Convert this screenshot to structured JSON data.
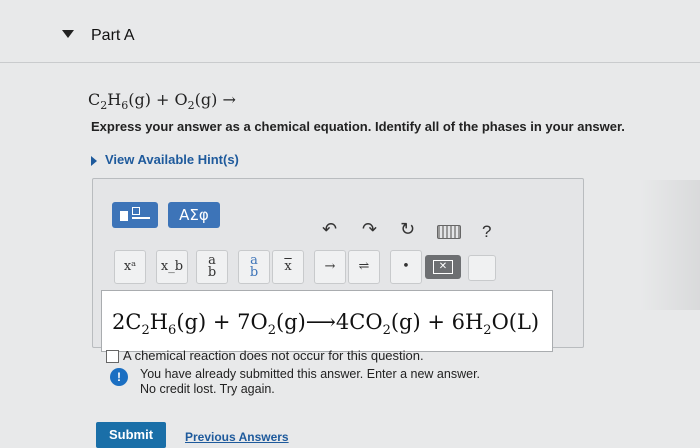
{
  "part": {
    "title": "Part A"
  },
  "question": {
    "reaction_parts": [
      "C",
      "2",
      "H",
      "6",
      "(g) + O",
      "2",
      "(g) →"
    ],
    "instructions": "Express your answer as a chemical equation. Identify all of the phases in your answer.",
    "hint_link": "View Available Hint(s)"
  },
  "toolbar": {
    "greek_label": "ΑΣφ",
    "undo_icon": "undo-icon",
    "redo_icon": "redo-icon",
    "reset_icon": "reset-icon",
    "help_label": "?",
    "buttons": {
      "superscript": "xᵃ",
      "subscript": "x_b",
      "fraction_a": "a",
      "fraction_b": "b",
      "vector": "x",
      "arrow": "→",
      "equilibrium": "⇌",
      "dot": "•"
    }
  },
  "answer": {
    "parts": [
      "2C",
      "2",
      "H",
      "6",
      "(g) + 7O",
      "2",
      "(g)⟶4CO",
      "2",
      "(g) + 6H",
      "2",
      "O(L)"
    ]
  },
  "no_reaction_label": "A chemical reaction does not occur for this question.",
  "feedback": {
    "line1": "You have already submitted this answer. Enter a new answer.",
    "line2": "No credit lost. Try again."
  },
  "actions": {
    "submit_label": "Submit",
    "previous_answers_label": "Previous Answers"
  }
}
